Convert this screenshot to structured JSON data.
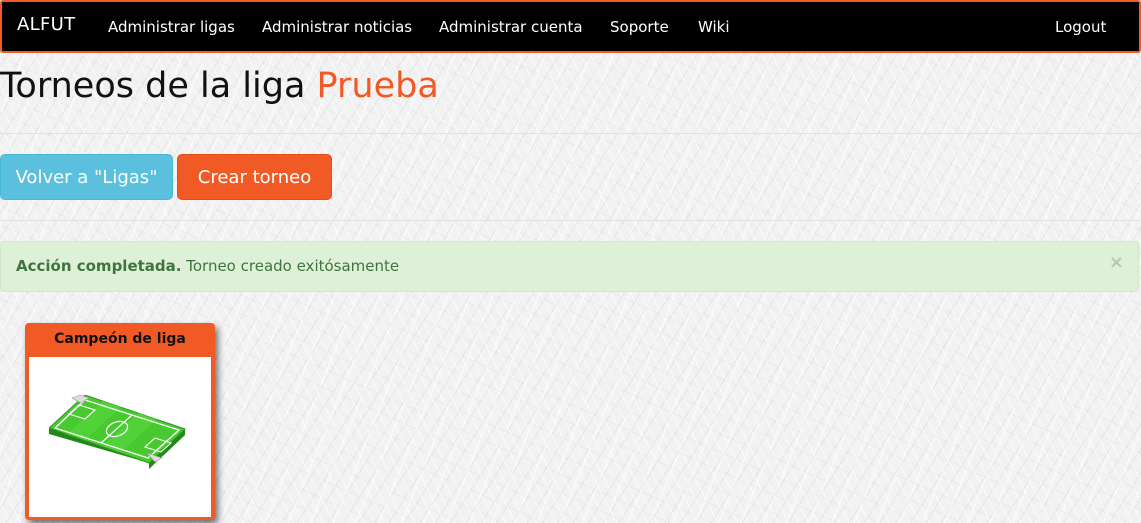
{
  "navbar": {
    "brand": "ALFUT",
    "items": [
      {
        "label": "Administrar ligas"
      },
      {
        "label": "Administrar noticias"
      },
      {
        "label": "Administrar cuenta"
      },
      {
        "label": "Soporte"
      },
      {
        "label": "Wiki"
      }
    ],
    "logout": "Logout"
  },
  "header": {
    "title_prefix": "Torneos de la liga",
    "league_name": "Prueba"
  },
  "actions": {
    "back_label": "Volver a \"Ligas\"",
    "create_label": "Crear torneo"
  },
  "alert": {
    "strong": "Acción completada.",
    "message": "Torneo creado exitósamente",
    "close": "×"
  },
  "tournaments": [
    {
      "name": "Campeón de liga",
      "icon": "soccer-field-icon"
    }
  ],
  "colors": {
    "accent": "#f15a24",
    "info": "#5bc0de",
    "success_bg": "#dff0d8",
    "success_text": "#3c763d",
    "navbar_bg": "#000000"
  }
}
